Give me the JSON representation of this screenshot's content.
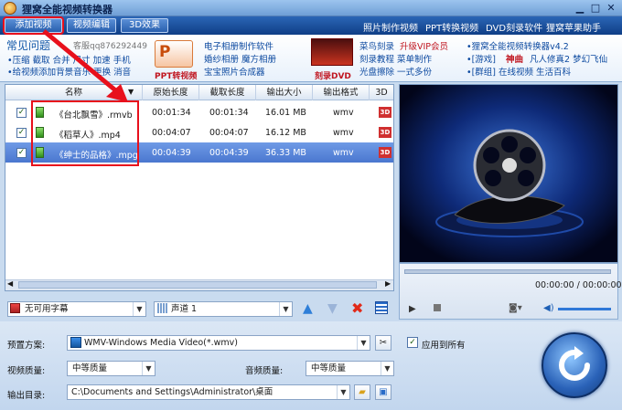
{
  "window": {
    "title": "狸窝全能视频转换器",
    "minimize": "▁",
    "maximize": "□",
    "close": "✕"
  },
  "tabs": [
    {
      "label": "添加视频"
    },
    {
      "label": "视频编辑"
    },
    {
      "label": "3D效果"
    }
  ],
  "top_links": [
    {
      "label": "照片制作视频"
    },
    {
      "label": "PPT转换视频"
    },
    {
      "label": "DVD刻录软件"
    },
    {
      "label": "狸窝苹果助手"
    }
  ],
  "faq": {
    "title": "常见问题",
    "qq": "客服qq876292449",
    "line1": "•压缩 截取 合并 尺寸 加速 手机",
    "line2": "•给视频添加背景音乐 更换 消音"
  },
  "promo1": {
    "icon_letter": "P",
    "label": "PPT转视频",
    "lines": [
      "电子相册制作软件",
      "婚纱相册 魔方相册",
      "宝宝照片合成器"
    ]
  },
  "promo2": {
    "label": "刻录DVD",
    "lines": [
      "菜鸟刻录",
      "刻录教程 菜单制作",
      "光盘擦除 一式多份"
    ],
    "vip": "升级VIP会员"
  },
  "promo3": {
    "lines": [
      "•狸窝全能视频转换器v4.2",
      "•[游戏]",
      "凡人修真2 梦幻飞仙",
      "•[群组] 在线视频 生活百科"
    ],
    "shenqu": "神曲"
  },
  "file_list": {
    "headers": [
      "名称",
      "原始长度",
      "截取长度",
      "输出大小",
      "输出格式",
      "3D"
    ],
    "rows": [
      {
        "name": "《台北飘雪》.rmvb",
        "orig": "00:01:34",
        "cut": "00:01:34",
        "size": "16.01 MB",
        "format": "wmv",
        "selected": false
      },
      {
        "name": "《稻草人》.mp4",
        "orig": "00:04:07",
        "cut": "00:04:07",
        "size": "16.12 MB",
        "format": "wmv",
        "selected": false
      },
      {
        "name": "《绅士的品格》.mpg",
        "orig": "00:04:39",
        "cut": "00:04:39",
        "size": "36.33 MB",
        "format": "wmv",
        "selected": true
      }
    ]
  },
  "player": {
    "timecode": "00:00:00 / 00:00:00"
  },
  "subtitle": {
    "value": "无可用字幕"
  },
  "audio": {
    "value": "声道 1"
  },
  "bottom": {
    "preset_label": "预置方案:",
    "preset_value": "WMV-Windows Media Video(*.wmv)",
    "apply_all": "应用到所有",
    "video_quality_label": "视频质量:",
    "video_quality_value": "中等质量",
    "audio_quality_label": "音频质量:",
    "audio_quality_value": "中等质量",
    "output_label": "输出目录:",
    "output_value": "C:\\Documents and Settings\\Administrator\\桌面"
  },
  "colors": {
    "accent": "#e8101c",
    "brand": "#1a56b0"
  }
}
